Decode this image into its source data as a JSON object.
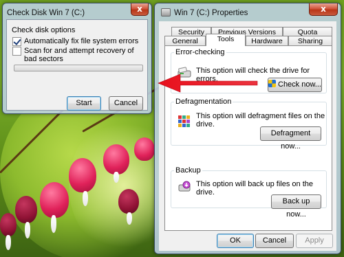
{
  "check_disk": {
    "title": "Check Disk Win 7 (C:)",
    "close_symbol": "x",
    "options_label": "Check disk options",
    "options": [
      {
        "label": "Automatically fix file system errors",
        "checked": true
      },
      {
        "label": "Scan for and attempt recovery of bad sectors",
        "checked": false
      }
    ],
    "progress_fraction": 0,
    "start_label": "Start",
    "cancel_label": "Cancel"
  },
  "properties": {
    "title": "Win 7 (C:) Properties",
    "close_symbol": "x",
    "tabs_row1": [
      "Security",
      "Previous Versions",
      "Quota"
    ],
    "tabs_row2": [
      "General",
      "Tools",
      "Hardware",
      "Sharing"
    ],
    "active_tab": "Tools",
    "sections": {
      "error_checking": {
        "label": "Error-checking",
        "text": "This option will check the drive for errors.",
        "button": "Check now...",
        "icon": "drive-check-icon"
      },
      "defragmentation": {
        "label": "Defragmentation",
        "text": "This option will defragment files on the drive.",
        "button": "Defragment now...",
        "icon": "defrag-icon"
      },
      "backup": {
        "label": "Backup",
        "text": "This option will back up files on the drive.",
        "button": "Back up now...",
        "icon": "backup-icon"
      }
    },
    "ok_label": "OK",
    "cancel_label": "Cancel",
    "apply_label": "Apply"
  },
  "annotation": {
    "arrow_color": "#e8101c",
    "icon": "red-arrow-icon"
  }
}
